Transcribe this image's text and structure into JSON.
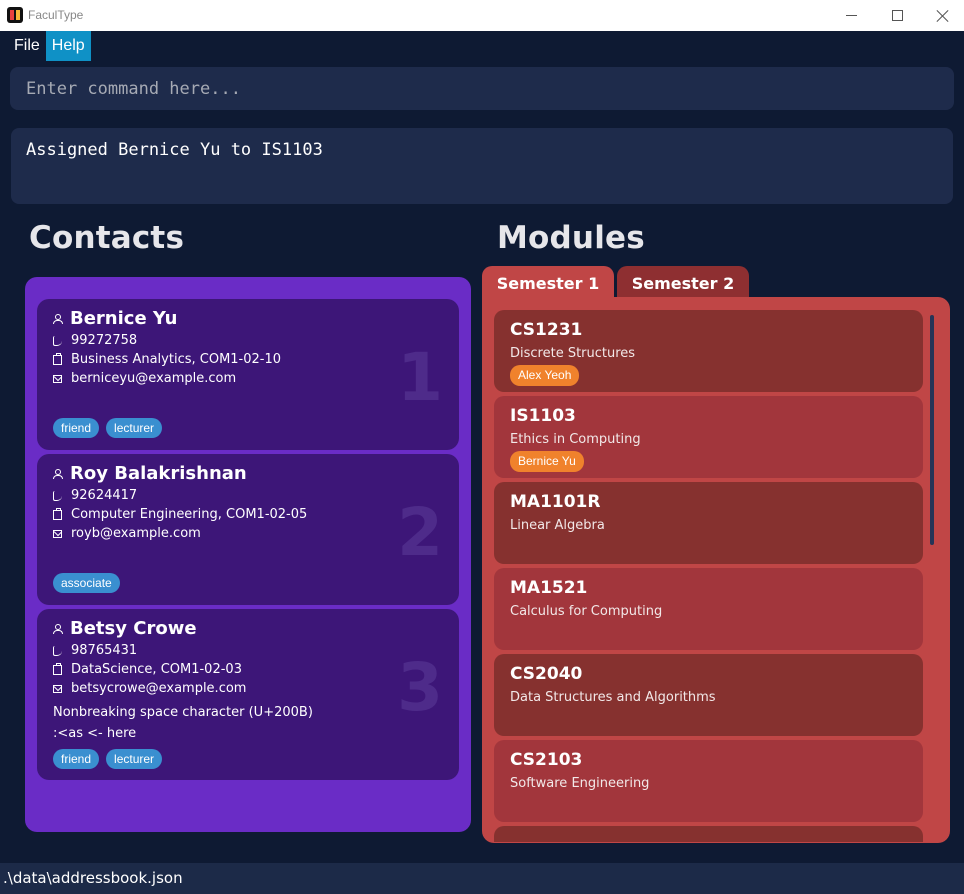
{
  "window": {
    "title": "FaculType"
  },
  "menu": {
    "file": "File",
    "help": "Help"
  },
  "command": {
    "placeholder": "Enter command here...",
    "value": ""
  },
  "result": {
    "text": "Assigned Bernice Yu to IS1103"
  },
  "headings": {
    "contacts": "Contacts",
    "modules": "Modules"
  },
  "contacts": [
    {
      "index": "1",
      "name": "Bernice Yu",
      "phone": "99272758",
      "office": "Business Analytics, COM1-02-10",
      "email": "berniceyu@example.com",
      "note": "",
      "note2": "",
      "tags": [
        "friend",
        "lecturer"
      ]
    },
    {
      "index": "2",
      "name": "Roy Balakrishnan",
      "phone": "92624417",
      "office": "Computer Engineering, COM1-02-05",
      "email": "royb@example.com",
      "note": "",
      "note2": "",
      "tags": [
        "associate"
      ]
    },
    {
      "index": "3",
      "name": "Betsy Crowe",
      "phone": "98765431",
      "office": "DataScience, COM1-02-03",
      "email": "betsycrowe@example.com",
      "note": "Nonbreaking space character (U+200B)",
      "note2": ":<as <- here",
      "tags": [
        "friend",
        "lecturer"
      ]
    }
  ],
  "tabs": [
    "Semester 1",
    "Semester 2"
  ],
  "modules": [
    {
      "code": "CS1231",
      "name": "Discrete Structures",
      "assignee": "Alex Yeoh"
    },
    {
      "code": "IS1103",
      "name": "Ethics in Computing",
      "assignee": "Bernice Yu"
    },
    {
      "code": "MA1101R",
      "name": "Linear Algebra",
      "assignee": ""
    },
    {
      "code": "MA1521",
      "name": "Calculus for Computing",
      "assignee": ""
    },
    {
      "code": "CS2040",
      "name": "Data Structures and Algorithms",
      "assignee": ""
    },
    {
      "code": "CS2103",
      "name": "Software Engineering",
      "assignee": ""
    }
  ],
  "status": {
    "path": ".\\data\\addressbook.json"
  }
}
